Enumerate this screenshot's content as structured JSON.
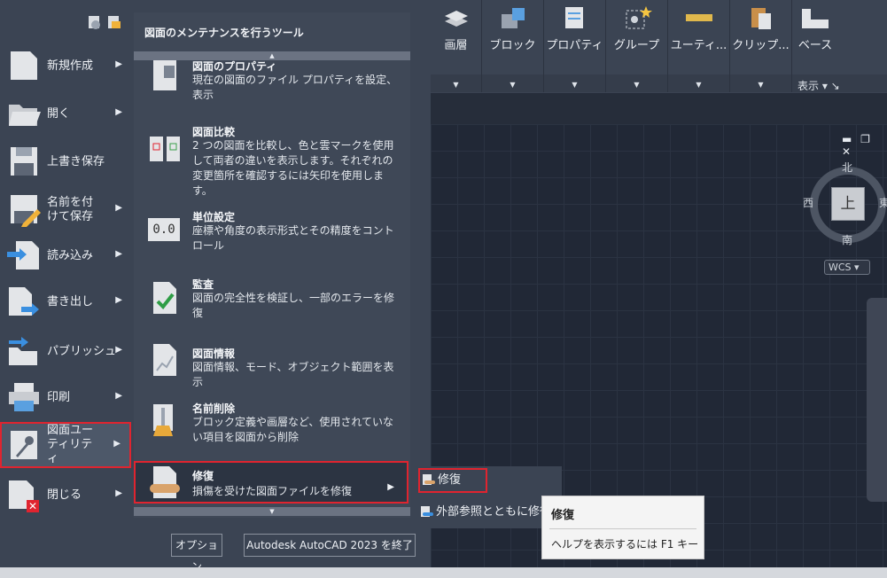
{
  "ribbon": {
    "buttons": [
      {
        "label": "画層"
      },
      {
        "label": "ブロック"
      },
      {
        "label": "プロパティ"
      },
      {
        "label": "グループ"
      },
      {
        "label": "ユーティ..."
      },
      {
        "label": "クリップ..."
      },
      {
        "label": "ベース"
      }
    ],
    "panel_title": "表示 ▾ ↘"
  },
  "viewcube": {
    "north": "北",
    "south": "南",
    "west": "西",
    "east": "東",
    "face": "上",
    "wcs": "WCS ▾"
  },
  "app_menu": {
    "left_items": [
      {
        "label": "新規作成"
      },
      {
        "label": "開く"
      },
      {
        "label": "上書き保存"
      },
      {
        "label": "名前を付けて保存"
      },
      {
        "label": "読み込み"
      },
      {
        "label": "書き出し"
      },
      {
        "label": "パブリッシュ"
      },
      {
        "label": "印刷"
      },
      {
        "label": "図面ユーティリティ"
      },
      {
        "label": "閉じる"
      }
    ],
    "sub_title": "図面のメンテナンスを行うツール",
    "sub_items": [
      {
        "title": "図面のプロパティ",
        "desc": "現在の図面のファイル プロパティを設定、表示"
      },
      {
        "title": "図面比較",
        "desc": "2 つの図面を比較し、色と雲マークを使用して両者の違いを表示します。それぞれの変更箇所を確認するには矢印を使用します。"
      },
      {
        "title": "単位設定",
        "desc": "座標や角度の表示形式とその精度をコントロール",
        "icon_text": "0.0"
      },
      {
        "title": "監査",
        "desc": "図面の完全性を検証し、一部のエラーを修復"
      },
      {
        "title": "図面情報",
        "desc": "図面情報、モード、オブジェクト範囲を表示"
      },
      {
        "title": "名前削除",
        "desc": "ブロック定義や画層など、使用されていない項目を図面から削除"
      },
      {
        "title": "修復",
        "desc": "損傷を受けた図面ファイルを修復"
      }
    ],
    "options_button": "オプション",
    "exit_button": "Autodesk AutoCAD 2023 を終了"
  },
  "cascade": {
    "items": [
      {
        "label": "修復"
      },
      {
        "label": "外部参照とともに修復"
      }
    ]
  },
  "tooltip": {
    "title": "修復",
    "help": "ヘルプを表示するには F1 キー"
  },
  "colors": {
    "menu_bg": "#3b4453",
    "highlight_border": "#e0242f",
    "canvas_bg": "#212836"
  }
}
